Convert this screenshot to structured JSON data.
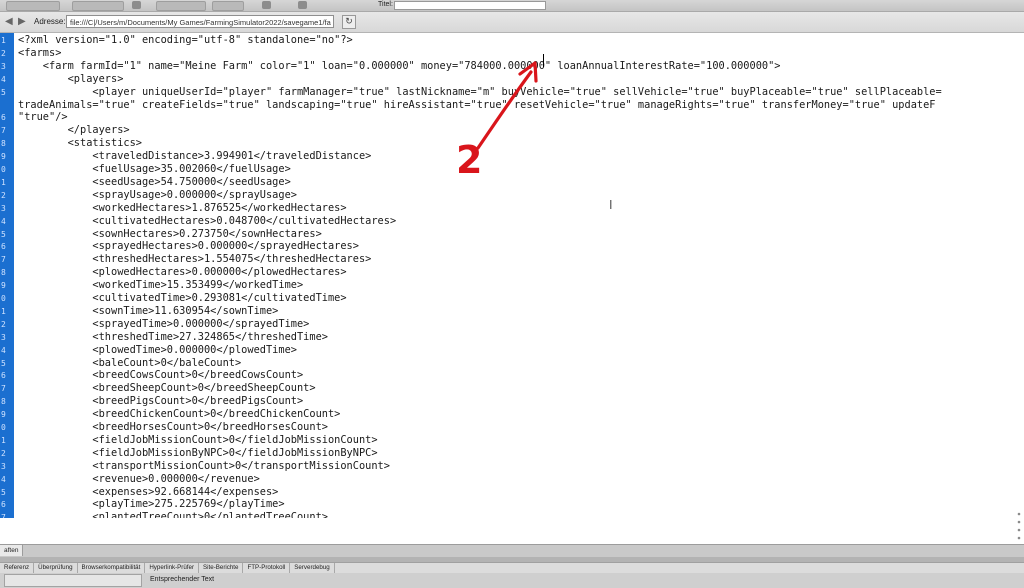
{
  "toolbar": {
    "tabs": [
      "",
      "",
      "",
      "",
      ""
    ],
    "title_label": "Titel:"
  },
  "address_bar": {
    "back_symbol": "◀",
    "forward_symbol": "▶",
    "label": "Adresse:",
    "value": "file:///C|/Users/m/Documents/My Games/FarmingSimulator2022/savegame1/fa",
    "go_symbol": "↻"
  },
  "editor": {
    "line_numbers": [
      "1",
      "2",
      "3",
      "4",
      "5",
      "",
      "6",
      "7",
      "8",
      "9",
      "0",
      "1",
      "2",
      "3",
      "4",
      "5",
      "6",
      "7",
      "8",
      "9",
      "0",
      "1",
      "2",
      "3",
      "4",
      "5",
      "6",
      "7",
      "8",
      "9",
      "0",
      "1",
      "2",
      "3",
      "4",
      "5",
      "6",
      "7"
    ],
    "lines": [
      "<?xml version=\"1.0\" encoding=\"utf-8\" standalone=\"no\"?>",
      "<farms>",
      "    <farm farmId=\"1\" name=\"Meine Farm\" color=\"1\" loan=\"0.000000\" money=\"784000.000000\" loanAnnualInterestRate=\"100.000000\">",
      "        <players>",
      "            <player uniqueUserId=\"player\" farmManager=\"true\" lastNickname=\"m\" buyVehicle=\"true\" sellVehicle=\"true\" buyPlaceable=\"true\" sellPlaceable=",
      "tradeAnimals=\"true\" createFields=\"true\" landscaping=\"true\" hireAssistant=\"true\" resetVehicle=\"true\" manageRights=\"true\" transferMoney=\"true\" updateF",
      "\"true\"/>",
      "        </players>",
      "        <statistics>",
      "            <traveledDistance>3.994901</traveledDistance>",
      "            <fuelUsage>35.002060</fuelUsage>",
      "            <seedUsage>54.750000</seedUsage>",
      "            <sprayUsage>0.000000</sprayUsage>",
      "            <workedHectares>1.876525</workedHectares>",
      "            <cultivatedHectares>0.048700</cultivatedHectares>",
      "            <sownHectares>0.273750</sownHectares>",
      "            <sprayedHectares>0.000000</sprayedHectares>",
      "            <threshedHectares>1.554075</threshedHectares>",
      "            <plowedHectares>0.000000</plowedHectares>",
      "            <workedTime>15.353499</workedTime>",
      "            <cultivatedTime>0.293081</cultivatedTime>",
      "            <sownTime>11.630954</sownTime>",
      "            <sprayedTime>0.000000</sprayedTime>",
      "            <threshedTime>27.324865</threshedTime>",
      "            <plowedTime>0.000000</plowedTime>",
      "            <baleCount>0</baleCount>",
      "            <breedCowsCount>0</breedCowsCount>",
      "            <breedSheepCount>0</breedSheepCount>",
      "            <breedPigsCount>0</breedPigsCount>",
      "            <breedChickenCount>0</breedChickenCount>",
      "            <breedHorsesCount>0</breedHorsesCount>",
      "            <fieldJobMissionCount>0</fieldJobMissionCount>",
      "            <fieldJobMissionByNPC>0</fieldJobMissionByNPC>",
      "            <transportMissionCount>0</transportMissionCount>",
      "            <revenue>0.000000</revenue>",
      "            <expenses>92.668144</expenses>",
      "            <playTime>275.225769</playTime>",
      "            <plantedTreeCount>0</plantedTreeCount>"
    ]
  },
  "annotation": {
    "number": "2",
    "color": "#d9151b"
  },
  "bottom_panel": {
    "tab_label": "aften",
    "result_tabs": [
      "Referenz",
      "Überprüfung",
      "Browserkompatibilität",
      "Hyperlink-Prüfer",
      "Site-Berichte",
      "FTP-Protokoll",
      "Serverdebug"
    ]
  },
  "status": {
    "text": "Entsprechender Text"
  }
}
